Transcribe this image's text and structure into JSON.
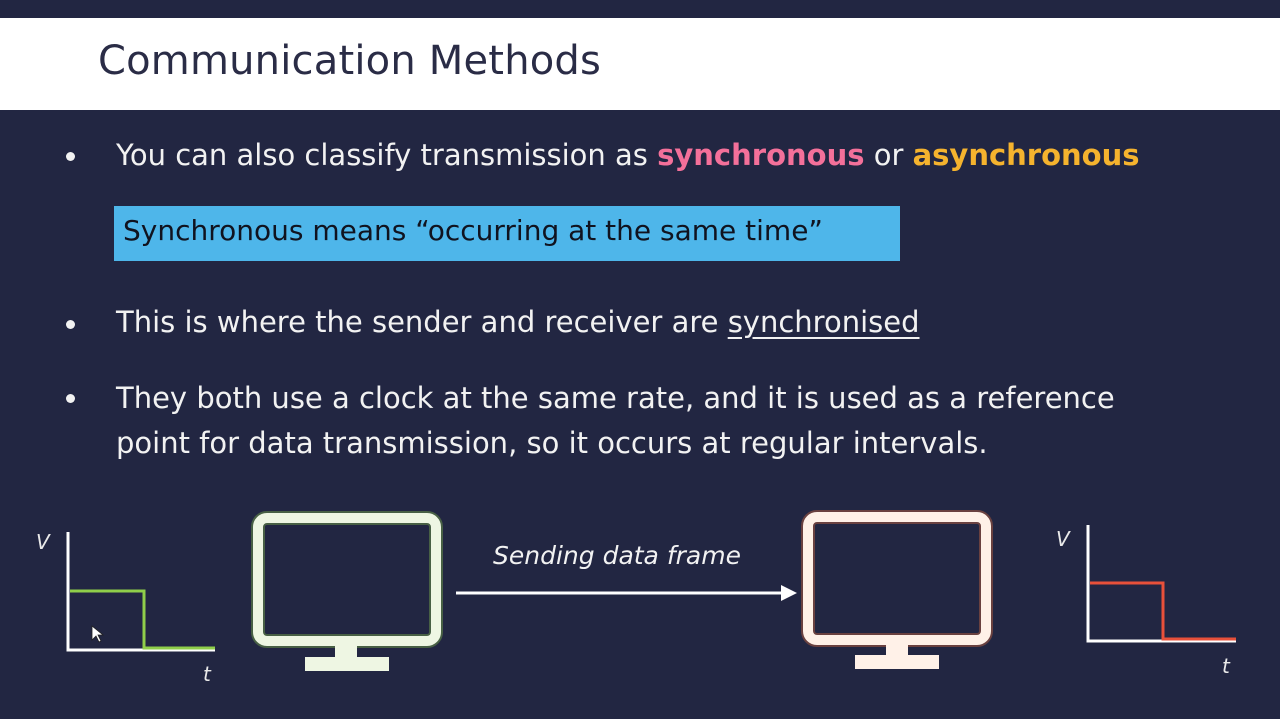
{
  "slide": {
    "title": "Communication Methods",
    "bullet1": {
      "before": "You can also classify transmission as ",
      "sync_word": "synchronous",
      "middle": " or ",
      "async_word": "asynchronous"
    },
    "definition": "Synchronous means “occurring at the same time”",
    "bullet2": {
      "before": "This is where the sender and receiver are ",
      "underlined": "synchronised"
    },
    "bullet3": {
      "line1": "They both use a clock at the same rate, and it is used as a reference",
      "line2": "point for data transmission, so it occurs at regular intervals."
    }
  },
  "diagram": {
    "frame_label": "Sending data frame",
    "left_graph": {
      "y_label": "V",
      "x_label": "t"
    },
    "right_graph": {
      "y_label": "V",
      "x_label": "t"
    }
  },
  "colors": {
    "background": "#222642",
    "sync_pink": "#f4709a",
    "async_orange": "#f5b32e",
    "definition_box": "#4eb6ea",
    "sender_monitor": "#eef6e3",
    "sender_glow": "#8fce4a",
    "receiver_monitor": "#fff1e8",
    "receiver_glow": "#f0763c",
    "left_signal": "#8fce4a",
    "right_signal": "#e8503a"
  }
}
